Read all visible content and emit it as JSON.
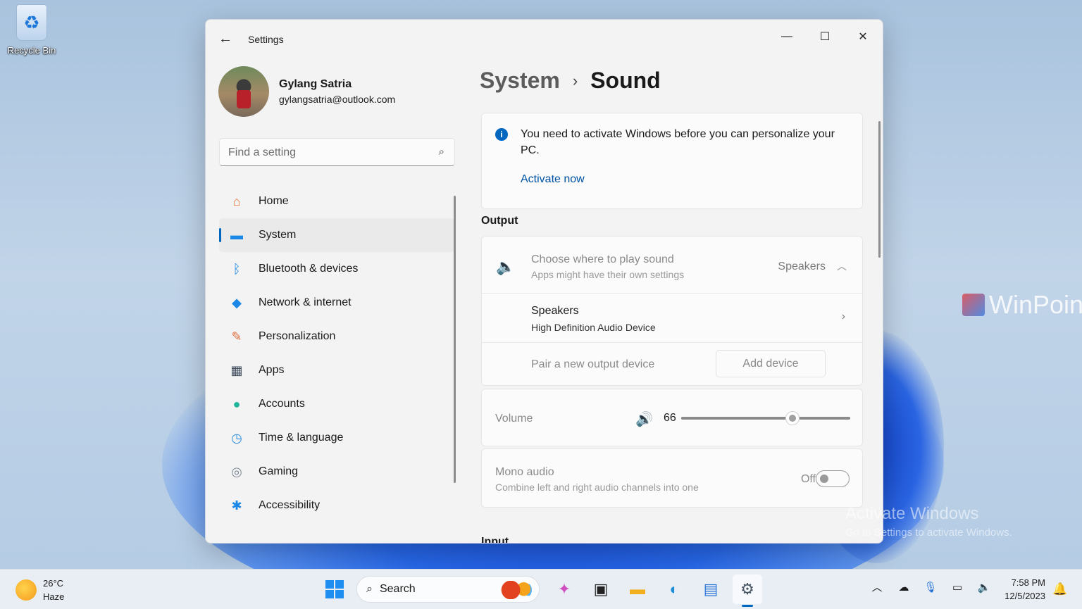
{
  "desktop": {
    "recycle_bin_label": "Recycle Bin",
    "watermark_logo": "WinPoin",
    "activate_title": "Activate Windows",
    "activate_sub": "Go to Settings to activate Windows."
  },
  "window": {
    "title": "Settings",
    "back_icon": "←",
    "min_icon": "—",
    "max_icon": "☐",
    "close_icon": "✕"
  },
  "profile": {
    "name": "Gylang Satria",
    "email": "gylangsatria@outlook.com"
  },
  "search": {
    "placeholder": "Find a setting",
    "icon": "⌕"
  },
  "nav": {
    "items": [
      {
        "label": "Home",
        "icon": "⌂",
        "color": "#e8733a",
        "active": false
      },
      {
        "label": "System",
        "icon": "▬",
        "color": "#1b87e6",
        "active": true
      },
      {
        "label": "Bluetooth & devices",
        "icon": "ᛒ",
        "color": "#1b87e6",
        "active": false
      },
      {
        "label": "Network & internet",
        "icon": "◆",
        "color": "#1b87e6",
        "active": false
      },
      {
        "label": "Personalization",
        "icon": "✎",
        "color": "#e06a3b",
        "active": false
      },
      {
        "label": "Apps",
        "icon": "▦",
        "color": "#3c4a5c",
        "active": false
      },
      {
        "label": "Accounts",
        "icon": "●",
        "color": "#1fb59a",
        "active": false
      },
      {
        "label": "Time & language",
        "icon": "◷",
        "color": "#2a8ce0",
        "active": false
      },
      {
        "label": "Gaming",
        "icon": "◎",
        "color": "#7b8794",
        "active": false
      },
      {
        "label": "Accessibility",
        "icon": "✱",
        "color": "#1b87e6",
        "active": false
      }
    ]
  },
  "breadcrumb": {
    "parent": "System",
    "separator": "›",
    "current": "Sound"
  },
  "info": {
    "icon": "i",
    "text": "You need to activate Windows before you can personalize your PC.",
    "link": "Activate now"
  },
  "output": {
    "heading": "Output",
    "choose_title": "Choose where to play sound",
    "choose_sub": "Apps might have their own settings",
    "choose_value": "Speakers",
    "choose_chevron": "︿",
    "device_title": "Speakers",
    "device_sub": "High Definition Audio Device",
    "device_chevron": "›",
    "pair_label": "Pair a new output device",
    "add_button": "Add device"
  },
  "volume": {
    "label": "Volume",
    "icon": "🔊",
    "value": "66",
    "level": 0.66
  },
  "mono": {
    "title": "Mono audio",
    "subtitle": "Combine left and right audio channels into one",
    "state": "Off"
  },
  "input_heading": "Input",
  "taskbar": {
    "temp": "26°C",
    "condition": "Haze",
    "search_placeholder": "Search",
    "clock_time": "7:58 PM",
    "clock_date": "12/5/2023",
    "tray_icons": [
      "chevron-up-icon",
      "onedrive-cloud-icon",
      "microphone-icon",
      "network-icon",
      "speaker-icon"
    ],
    "tray_glyphs": [
      "︿",
      "☁",
      "🎙",
      "▭",
      "🔈"
    ]
  }
}
